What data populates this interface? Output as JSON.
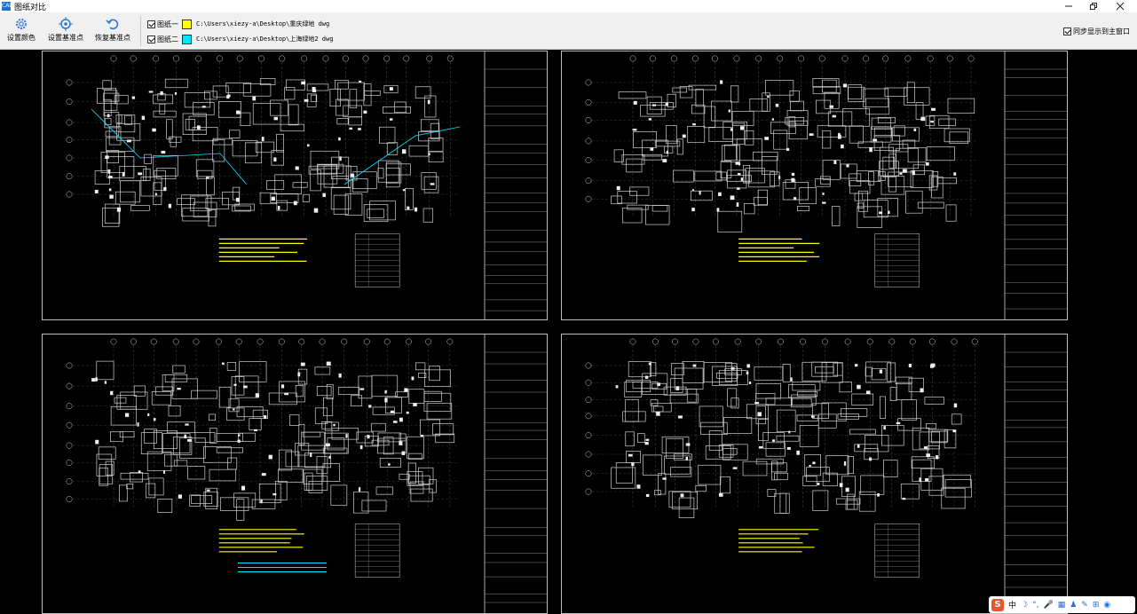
{
  "window": {
    "title": "图纸对比",
    "app_icon": "CAD"
  },
  "toolbar": {
    "buttons": [
      {
        "label": "设置颜色",
        "icon": "gear-icon"
      },
      {
        "label": "设置基准点",
        "icon": "crosshair-icon"
      },
      {
        "label": "恢复基准点",
        "icon": "undo-arrow-icon"
      }
    ],
    "files": [
      {
        "label": "图纸一",
        "checked": true,
        "color": "#ffff00",
        "path": "C:\\Users\\xiezy-a\\Desktop\\重庆绿地 dwg"
      },
      {
        "label": "图纸二",
        "checked": true,
        "color": "#00e5ff",
        "path": "C:\\Users\\xiezy-a\\Desktop\\上海绿地2 dwg"
      }
    ],
    "sync": {
      "label": "同步显示到主窗口",
      "checked": true
    }
  },
  "ime": {
    "logo": "S",
    "mode": "中",
    "items": [
      "☽",
      "°,",
      "🎤",
      "▦",
      "♟",
      "✎",
      "⊞",
      "◉"
    ]
  },
  "colors": {
    "highlight_yellow": "#ffff00",
    "highlight_cyan": "#00e5ff",
    "drawing_lines": "#d9d9d9",
    "background": "#000000"
  }
}
